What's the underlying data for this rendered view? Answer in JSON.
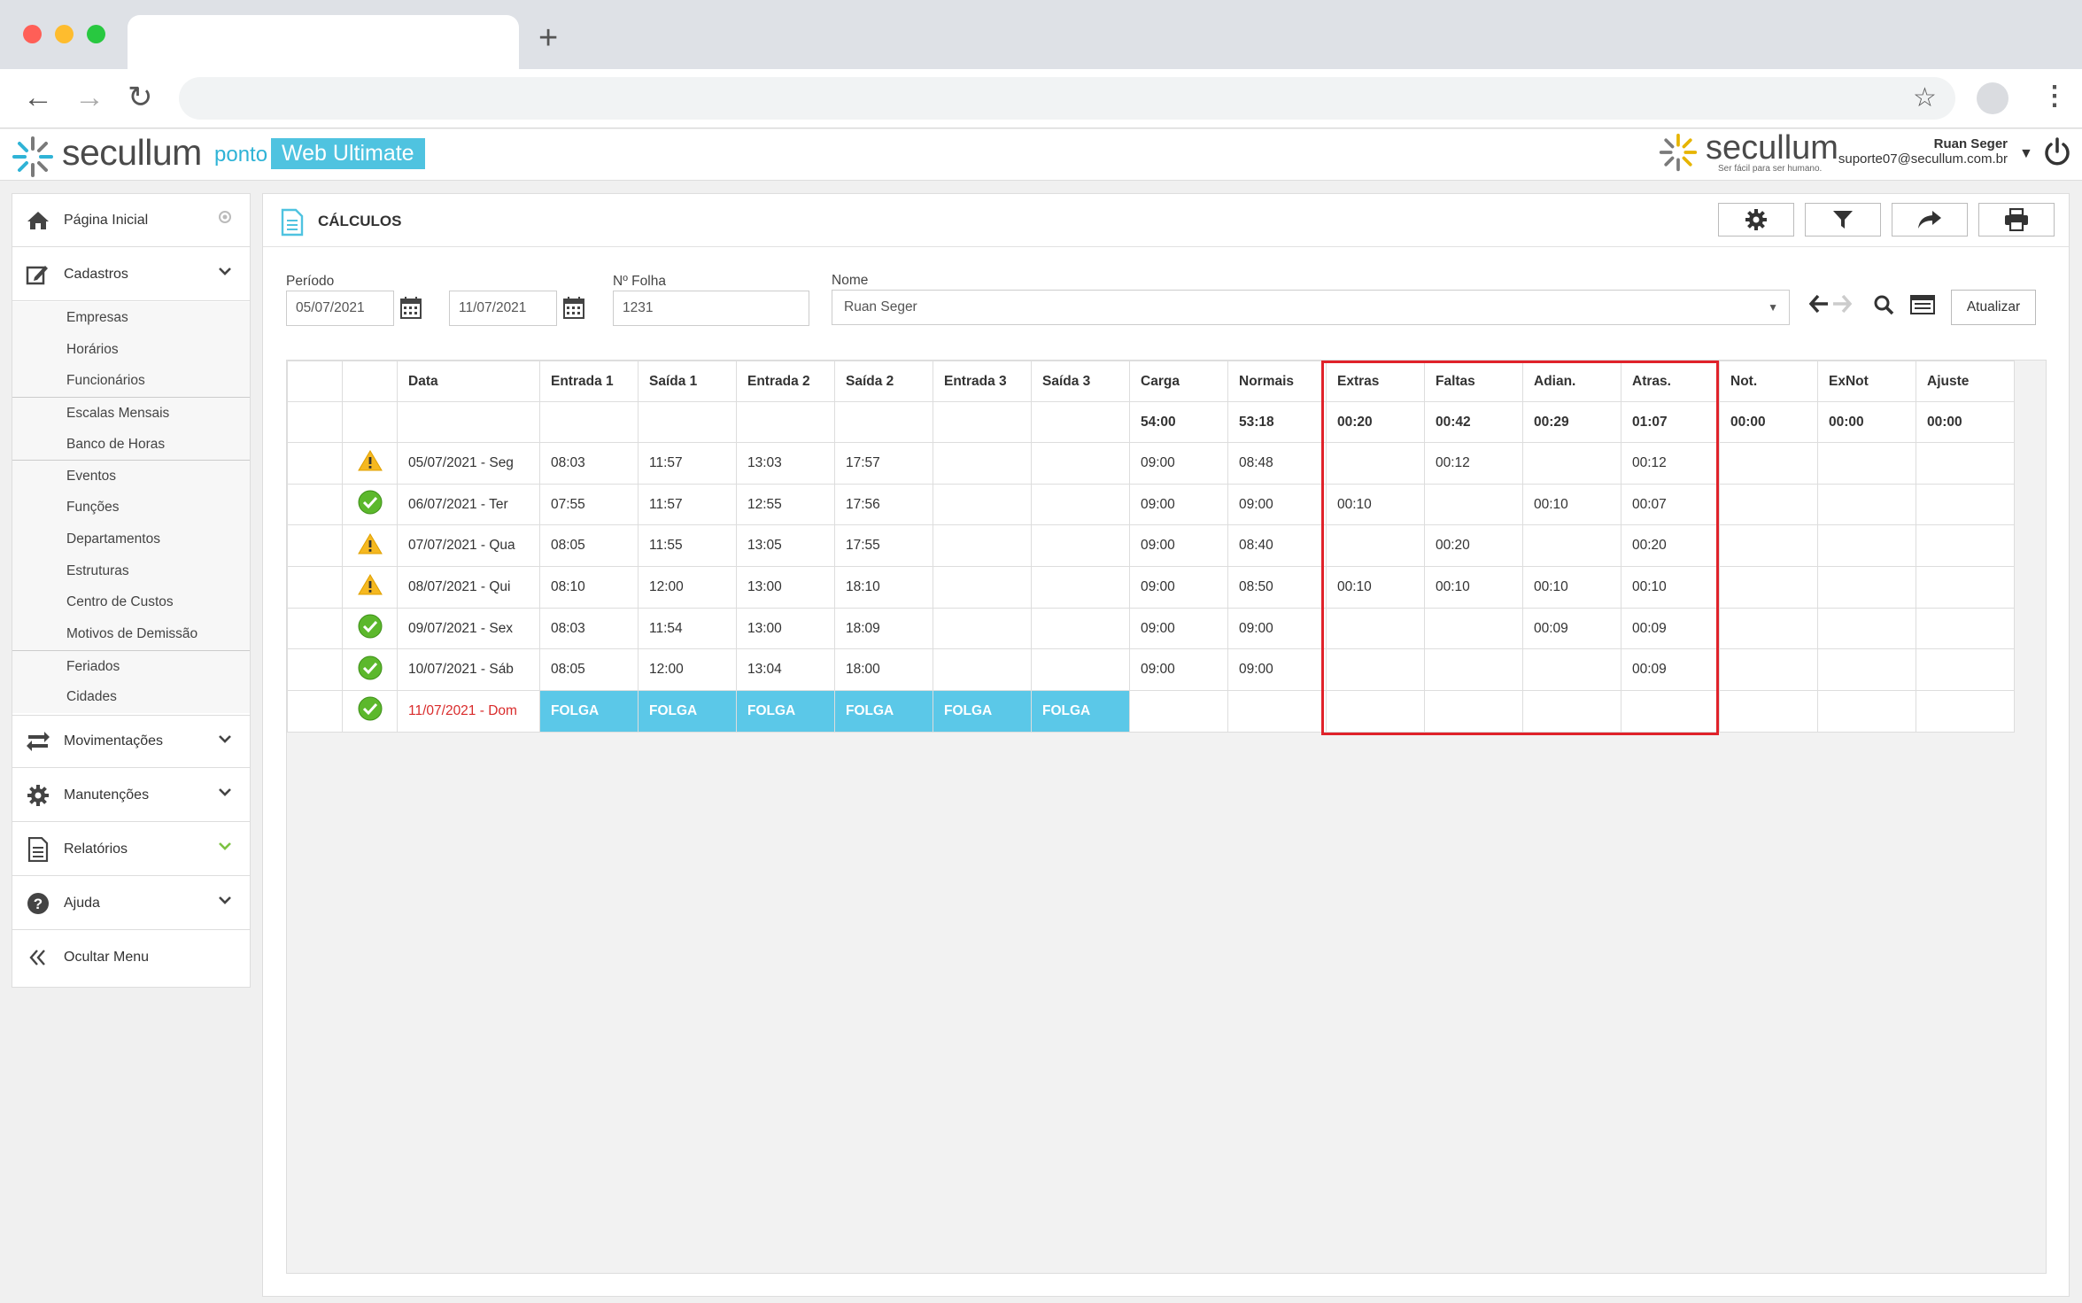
{
  "browser": {
    "new_tab_label": "+",
    "back_glyph": "←",
    "forward_glyph": "→",
    "reload_glyph": "↻",
    "star_glyph": "☆",
    "menu_glyph": "⋮"
  },
  "header": {
    "brand": "secullum",
    "brand_ponto": "ponto",
    "brand_product": "Web Ultimate",
    "brand_right": "secullum",
    "brand_right_tagline": "Ser fácil para ser humano.",
    "user_name": "Ruan Seger",
    "user_email": "suporte07@secullum.com.br",
    "accent_color": "#4fc3e0"
  },
  "sidebar": {
    "items": [
      {
        "label": "Página Inicial",
        "icon": "home-icon"
      },
      {
        "label": "Cadastros",
        "icon": "edit-icon"
      },
      {
        "label": "Movimentações",
        "icon": "exchange-icon"
      },
      {
        "label": "Manutenções",
        "icon": "gear-icon"
      },
      {
        "label": "Relatórios",
        "icon": "document-icon"
      },
      {
        "label": "Ajuda",
        "icon": "help-icon"
      },
      {
        "label": "Ocultar Menu",
        "icon": "double-chevron-left-icon"
      }
    ],
    "cadastros_sub": [
      "Empresas",
      "Horários",
      "Funcionários",
      "Escalas Mensais",
      "Banco de Horas",
      "Eventos",
      "Funções",
      "Departamentos",
      "Estruturas",
      "Centro de Custos",
      "Motivos de Demissão",
      "Feriados",
      "Cidades"
    ]
  },
  "page": {
    "title": "CÁLCULOS",
    "period_label": "Período",
    "period_start": "05/07/2021",
    "period_end": "11/07/2021",
    "folha_label": "Nº Folha",
    "folha_value": "1231",
    "name_label": "Nome",
    "name_value": "Ruan Seger",
    "update_button": "Atualizar"
  },
  "grid": {
    "columns": [
      "",
      "",
      "Data",
      "Entrada 1",
      "Saída 1",
      "Entrada 2",
      "Saída 2",
      "Entrada 3",
      "Saída 3",
      "Carga",
      "Normais",
      "Extras",
      "Faltas",
      "Adian.",
      "Atras.",
      "Not.",
      "ExNot",
      "Ajuste"
    ],
    "totals": [
      "",
      "",
      "",
      "",
      "",
      "",
      "",
      "",
      "",
      "54:00",
      "53:18",
      "00:20",
      "00:42",
      "00:29",
      "01:07",
      "00:00",
      "00:00",
      "00:00"
    ],
    "rows": [
      {
        "status": "warning",
        "cells": [
          "05/07/2021 - Seg",
          "08:03",
          "11:57",
          "13:03",
          "17:57",
          "",
          "",
          "09:00",
          "08:48",
          "",
          "00:12",
          "",
          "00:12",
          "",
          "",
          ""
        ]
      },
      {
        "status": "ok",
        "cells": [
          "06/07/2021 - Ter",
          "07:55",
          "11:57",
          "12:55",
          "17:56",
          "",
          "",
          "09:00",
          "09:00",
          "00:10",
          "",
          "00:10",
          "00:07",
          "",
          "",
          ""
        ]
      },
      {
        "status": "warning",
        "cells": [
          "07/07/2021 - Qua",
          "08:05",
          "11:55",
          "13:05",
          "17:55",
          "",
          "",
          "09:00",
          "08:40",
          "",
          "00:20",
          "",
          "00:20",
          "",
          "",
          ""
        ]
      },
      {
        "status": "warning",
        "cells": [
          "08/07/2021 - Qui",
          "08:10",
          "12:00",
          "13:00",
          "18:10",
          "",
          "",
          "09:00",
          "08:50",
          "00:10",
          "00:10",
          "00:10",
          "00:10",
          "",
          "",
          ""
        ]
      },
      {
        "status": "ok",
        "cells": [
          "09/07/2021 - Sex",
          "08:03",
          "11:54",
          "13:00",
          "18:09",
          "",
          "",
          "09:00",
          "09:00",
          "",
          "",
          "00:09",
          "00:09",
          "",
          "",
          ""
        ]
      },
      {
        "status": "ok",
        "cells": [
          "10/07/2021 - Sáb",
          "08:05",
          "12:00",
          "13:04",
          "18:00",
          "",
          "",
          "09:00",
          "09:00",
          "",
          "",
          "",
          "00:09",
          "",
          "",
          ""
        ]
      },
      {
        "status": "ok",
        "cells": [
          "11/07/2021 - Dom",
          "FOLGA",
          "FOLGA",
          "FOLGA",
          "FOLGA",
          "FOLGA",
          "FOLGA",
          "",
          "",
          "",
          "",
          "",
          "",
          "",
          "",
          ""
        ]
      }
    ],
    "folga_color": "#5bc8e8",
    "highlight_color": "#e0222a"
  }
}
